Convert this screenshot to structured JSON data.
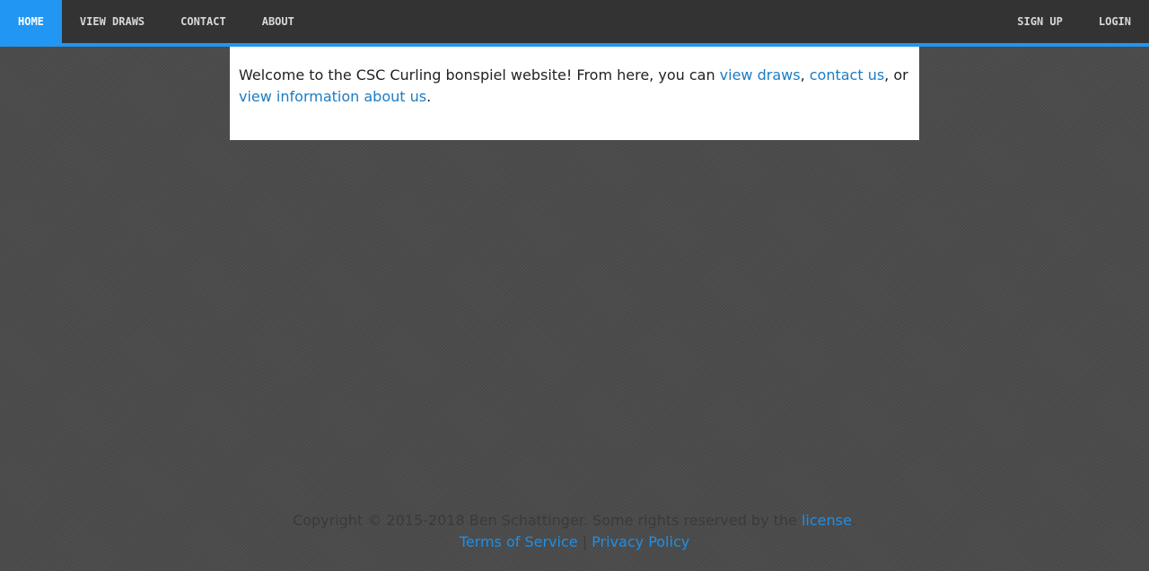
{
  "nav": {
    "left": [
      {
        "label": "HOME",
        "active": true
      },
      {
        "label": "VIEW DRAWS",
        "active": false
      },
      {
        "label": "CONTACT",
        "active": false
      },
      {
        "label": "ABOUT",
        "active": false
      }
    ],
    "right": [
      {
        "label": "SIGN UP"
      },
      {
        "label": "LOGIN"
      }
    ]
  },
  "main": {
    "intro_text": "Welcome to the CSC Curling bonspiel website! From here, you can ",
    "link_view_draws": "view draws",
    "comma": ", ",
    "link_contact_us": "contact us",
    "or_text": ", or ",
    "link_about_us": "view information about us",
    "period": "."
  },
  "footer": {
    "copyright_text": "Copyright © 2015-2018 Ben Schattinger. Some rights reserved by the ",
    "license_link": "license",
    "license_period": ".",
    "terms_link": "Terms of Service",
    "separator": " | ",
    "privacy_link": "Privacy Policy"
  },
  "colors": {
    "accent": "#2196f3",
    "navbar_bg": "#333333",
    "link": "#1b7cc4",
    "page_bg": "#4b4b4b"
  }
}
